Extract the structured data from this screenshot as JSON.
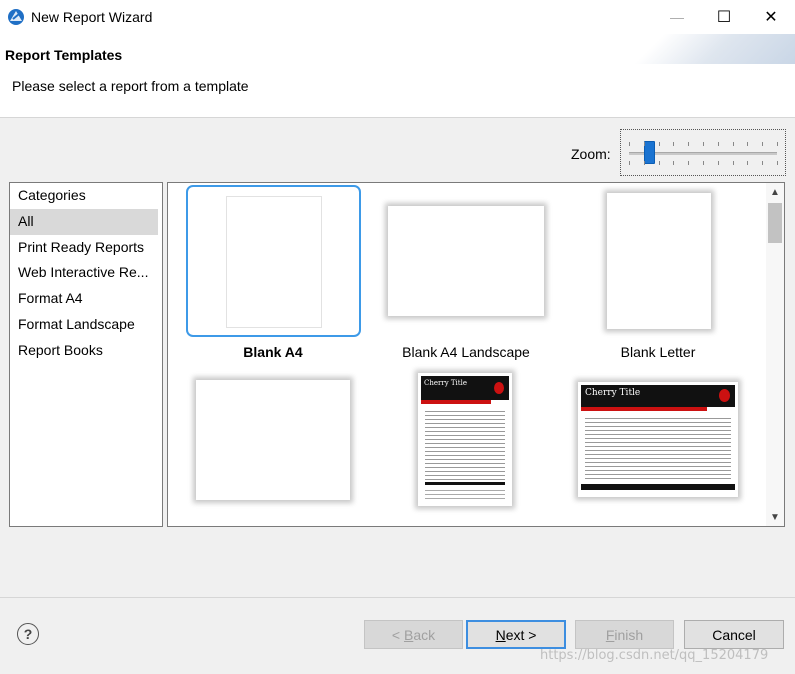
{
  "window": {
    "title": "New Report Wizard",
    "icon": "eclipse-birt-icon",
    "minimize_glyph": "—",
    "maximize_glyph": "☐",
    "close_glyph": "✕"
  },
  "header": {
    "title": "Report Templates",
    "subtitle": "Please select a report from a template"
  },
  "zoom": {
    "label": "Zoom:",
    "level": 0.1
  },
  "categories": {
    "header": "Categories",
    "items": [
      {
        "label": "All",
        "selected": true
      },
      {
        "label": "Print Ready Reports",
        "selected": false
      },
      {
        "label": "Web Interactive Re...",
        "selected": false
      },
      {
        "label": "Format A4",
        "selected": false
      },
      {
        "label": "Format Landscape",
        "selected": false
      },
      {
        "label": "Report Books",
        "selected": false
      }
    ]
  },
  "templates": [
    {
      "label": "Blank A4",
      "selected": true
    },
    {
      "label": "Blank A4 Landscape",
      "selected": false
    },
    {
      "label": "Blank Letter",
      "selected": false
    },
    {
      "label": "",
      "selected": false
    },
    {
      "label": "",
      "selected": false,
      "preview_title": "Cherry Title"
    },
    {
      "label": "",
      "selected": false,
      "preview_title": "Cherry Title"
    }
  ],
  "scrollbar": {
    "up_glyph": "▲",
    "down_glyph": "▼"
  },
  "footer": {
    "help_glyph": "?",
    "back_label": "< Back",
    "next_label": "Next >",
    "finish_label": "Finish",
    "cancel_label": "Cancel"
  },
  "watermark": "https://blog.csdn.net/qq_15204179",
  "colors": {
    "selection_border": "#3d9ae8",
    "zoom_thumb": "#1a73d1",
    "cherry_header": "#111111",
    "cherry_accent": "#cc1111"
  }
}
